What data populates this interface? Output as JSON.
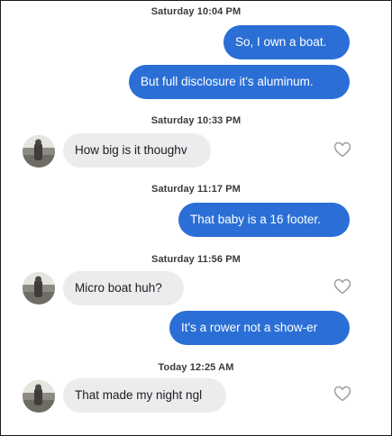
{
  "conversation": {
    "blocks": [
      {
        "timestamp": "Saturday 10:04 PM"
      },
      {
        "timestamp": "Saturday 10:33 PM"
      },
      {
        "timestamp": "Saturday 11:17 PM"
      },
      {
        "timestamp": "Saturday 11:56 PM"
      },
      {
        "timestamp": "Today 12:25 AM"
      }
    ],
    "messages": [
      {
        "text": "So, I own a boat.",
        "direction": "outgoing"
      },
      {
        "text": "But full disclosure it's aluminum.",
        "direction": "outgoing"
      },
      {
        "text": "How big is it thoughv",
        "direction": "incoming"
      },
      {
        "text": "That baby is a 16 footer.",
        "direction": "outgoing"
      },
      {
        "text": "Micro boat huh?",
        "direction": "incoming"
      },
      {
        "text": "It's a rower not a show-er",
        "direction": "outgoing"
      },
      {
        "text": "That made my night ngl",
        "direction": "incoming"
      }
    ]
  },
  "icons": {
    "like": "heart-outline-icon",
    "avatar": "contact-avatar"
  },
  "colors": {
    "outgoing_bubble": "#2b6fd6",
    "incoming_bubble": "#ececef",
    "timestamp_text": "#3a3a3a",
    "heart_outline": "#9a9aa0"
  }
}
